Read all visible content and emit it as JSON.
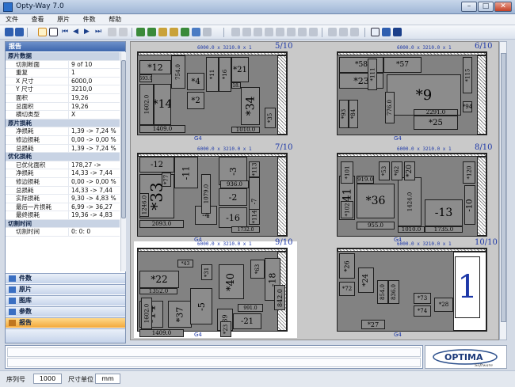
{
  "window": {
    "title": "Opty-Way 7.0"
  },
  "menu": [
    "文件",
    "查看",
    "原片",
    "件数",
    "帮助"
  ],
  "panel": {
    "title": "报告",
    "groups": [
      {
        "label": "原片数据",
        "rows": [
          {
            "k": "切割断面",
            "v": "9 of 10"
          },
          {
            "k": "重复",
            "v": "1"
          },
          {
            "k": "X 尺寸",
            "v": "6000,0"
          },
          {
            "k": "Y 尺寸",
            "v": "3210,0"
          },
          {
            "k": "面积",
            "v": "19,26"
          },
          {
            "k": "总面积",
            "v": "19,26"
          },
          {
            "k": "横切类型",
            "v": "X"
          }
        ]
      },
      {
        "label": "原片损耗",
        "rows": [
          {
            "k": "净损耗",
            "v": "1,39 -> 7,24 %"
          },
          {
            "k": "修边损耗",
            "v": "0,00 -> 0,00 %"
          },
          {
            "k": "总损耗",
            "v": "1,39 -> 7,24 %"
          }
        ]
      },
      {
        "label": "优化损耗",
        "rows": [
          {
            "k": "已优化面积",
            "v": "178,27 -> 100,00 %"
          },
          {
            "k": "净损耗",
            "v": "14,33 -> 7,44 %"
          },
          {
            "k": "修边损耗",
            "v": "0,00 -> 0,00 %"
          },
          {
            "k": "总损耗",
            "v": "14,33 -> 7,44 %"
          },
          {
            "k": "实际损耗",
            "v": "9,30 -> 4,83 %"
          },
          {
            "k": "最后一片损耗",
            "v": "6,99 -> 36,27 %"
          },
          {
            "k": "最终损耗",
            "v": "19,36 -> 4,83 %"
          }
        ]
      },
      {
        "label": "切割时间",
        "rows": [
          {
            "k": "切割时间",
            "v": "0: 0: 0"
          }
        ]
      }
    ],
    "nav": [
      "件数",
      "原片",
      "图库",
      "参数",
      "报告"
    ]
  },
  "sheet_header": "6000.0 x  3210.0 x 1",
  "material": "G4",
  "sheets": [
    {
      "page": "5/10",
      "pieces": [
        "*12",
        "693.0",
        "754.0",
        "1602.0",
        "*14",
        "1409.0",
        "*4",
        "*2",
        "*11",
        "*16",
        "*21",
        "*34",
        "918.0",
        "1010.0",
        "*35",
        "*81"
      ]
    },
    {
      "page": "6/10",
      "pieces": [
        "*58",
        "*57",
        "*23",
        "*9",
        "2291.0",
        "*25",
        "*115",
        "*94",
        "*111",
        "776.0",
        "*93",
        "*84"
      ]
    },
    {
      "page": "7/10",
      "pieces": [
        "-12",
        "-11",
        "-3",
        "*33",
        "2093.0",
        "-4",
        "-2",
        "-16",
        "-7",
        "936.0",
        "1079.0",
        "1246.0",
        "1732.0",
        "*113",
        "*114",
        "*77"
      ]
    },
    {
      "page": "8/10",
      "pieces": [
        "*36",
        "*41",
        "-13",
        "-10",
        "1735.0",
        "1010.0",
        "955.0",
        "1424.0",
        "*101",
        "*102",
        "*53",
        "*62",
        "*20",
        "919.0",
        "*120"
      ]
    },
    {
      "page": "9/10",
      "pieces": [
        "*22",
        "-14",
        "*37",
        "-5",
        "*40",
        "*39",
        "-18",
        "-21",
        "1409.0",
        "1352.0",
        "1602.0",
        "991.0",
        "842.0",
        "*23",
        "*31",
        "*43",
        "*63"
      ]
    },
    {
      "page": "10/10",
      "pieces": [
        "*26",
        "*24",
        "*72",
        "*27",
        "*73",
        "*74",
        "854.0",
        "836.0",
        "1",
        "*28"
      ]
    }
  ],
  "status": {
    "serial_label": "序列号",
    "serial_value": "1000",
    "unit_label": "尺寸单位",
    "unit_value": "mm"
  },
  "colors": {
    "accent": "#f3a83a",
    "panel": "#3d66ad",
    "dim_text": "#1d38a8"
  }
}
